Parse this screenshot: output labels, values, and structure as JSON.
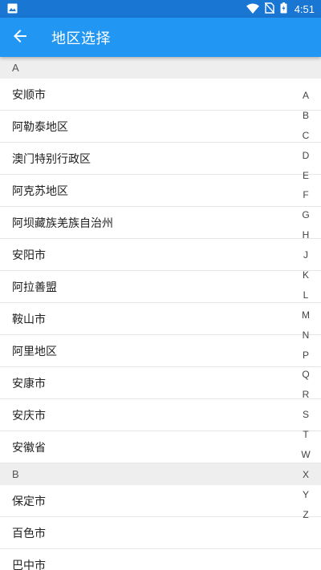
{
  "status_bar": {
    "time": "4:51",
    "icons": [
      "image-icon",
      "wifi-icon",
      "no-sim-icon",
      "battery-icon"
    ]
  },
  "app_bar": {
    "title": "地区选择",
    "back_icon": "arrow-back-icon"
  },
  "sections": [
    {
      "letter": "A",
      "items": [
        "安顺市",
        "阿勒泰地区",
        "澳门特别行政区",
        "阿克苏地区",
        "阿坝藏族羌族自治州",
        "安阳市",
        "阿拉善盟",
        "鞍山市",
        "阿里地区",
        "安康市",
        "安庆市",
        "安徽省"
      ]
    },
    {
      "letter": "B",
      "items": [
        "保定市",
        "百色市",
        "巴中市"
      ]
    }
  ],
  "index_letters": [
    "A",
    "B",
    "C",
    "D",
    "E",
    "F",
    "G",
    "H",
    "J",
    "K",
    "L",
    "M",
    "N",
    "P",
    "Q",
    "R",
    "S",
    "T",
    "W",
    "X",
    "Y",
    "Z"
  ],
  "colors": {
    "status_bar": "#1976d2",
    "app_bar": "#2196f3",
    "section_header_bg": "#eeeeee"
  }
}
